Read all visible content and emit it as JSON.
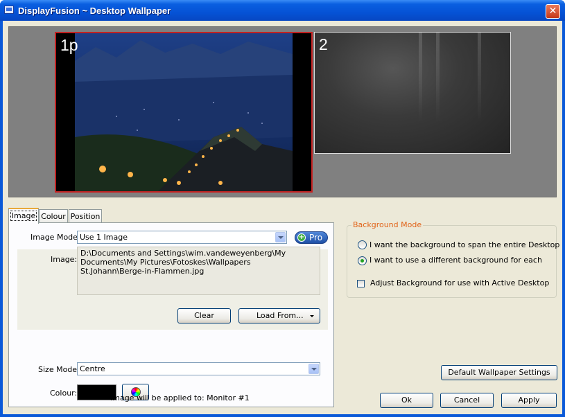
{
  "window": {
    "title": "DisplayFusion ~ Desktop Wallpaper",
    "close_label": "✕"
  },
  "preview": {
    "monitors": [
      {
        "label": "1p",
        "selected": true
      },
      {
        "label": "2",
        "selected": false
      }
    ]
  },
  "tabs": [
    {
      "label": "Image",
      "active": true
    },
    {
      "label": "Colour",
      "active": false
    },
    {
      "label": "Position",
      "active": false
    }
  ],
  "image_tab": {
    "image_mode_label": "Image Mode:",
    "image_mode_value": "Use 1 Image",
    "pro_label": "Pro",
    "image_label": "Image:",
    "image_path": "D:\\Documents and Settings\\wim.vandeweyenberg\\My Documents\\My Pictures\\Fotoskes\\Wallpapers St.Johann\\Berge-in-Flammen.jpg",
    "clear_label": "Clear",
    "load_from_label": "Load From...",
    "size_mode_label": "Size Mode:",
    "size_mode_value": "Centre",
    "colour_label": "Colour:",
    "colour_value": "#000000",
    "applied_text": "Image will be applied to: Monitor #1"
  },
  "background_mode": {
    "legend": "Background Mode",
    "options": [
      {
        "label": "I want the background to span the entire Desktop",
        "selected": false
      },
      {
        "label": "I want to use a different background for each",
        "selected": true
      }
    ],
    "active_desktop_label": "Adjust Background for use with Active Desktop",
    "active_desktop_checked": false
  },
  "buttons": {
    "default_settings": "Default Wallpaper Settings",
    "ok": "Ok",
    "cancel": "Cancel",
    "apply": "Apply"
  },
  "colors": {
    "titlebar": "#0553d6",
    "dialog_bg": "#ece9d8",
    "legend_text": "#e1641a",
    "selected_monitor_border": "#c42222"
  }
}
